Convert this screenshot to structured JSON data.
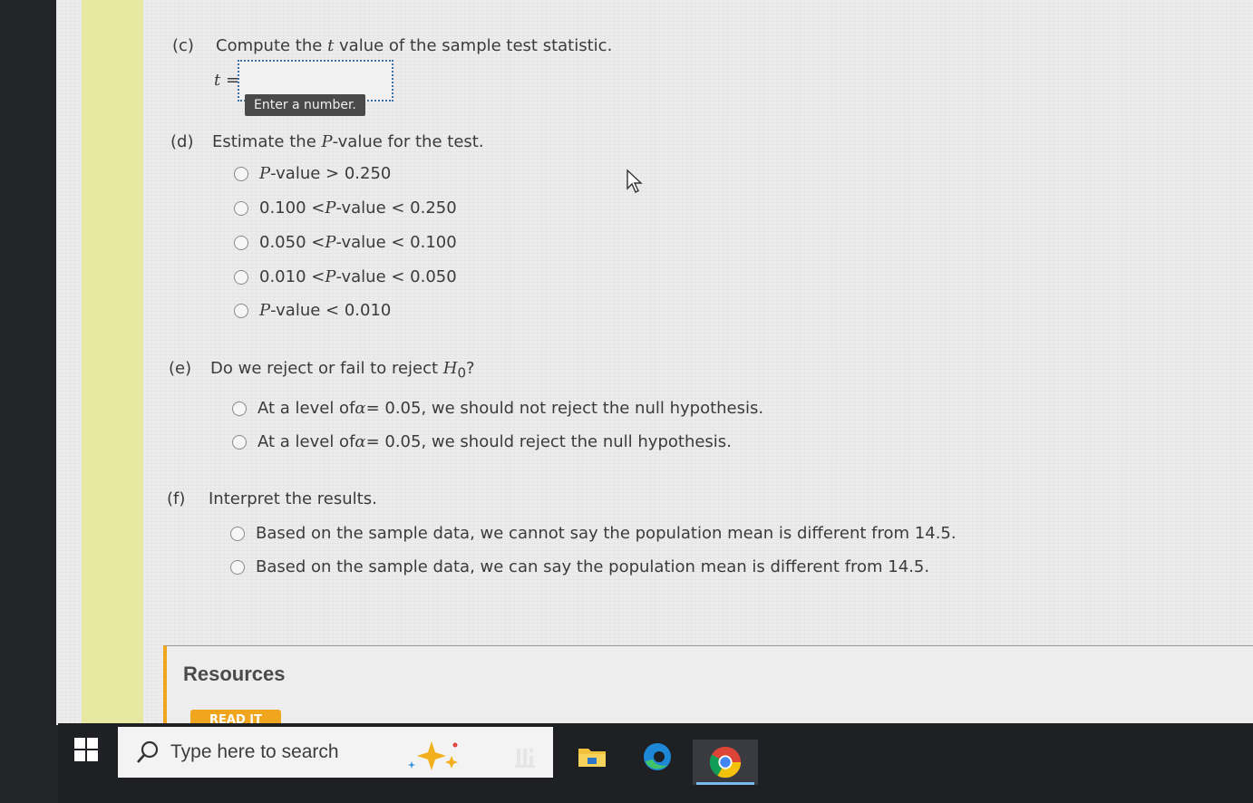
{
  "questions": {
    "c": {
      "label": "(c)",
      "text_pre": "Compute the ",
      "text_var": "t",
      "text_post": " value of the sample test statistic.",
      "input_var": "t",
      "input_eq": "=",
      "input_value": "",
      "tooltip": "Enter a number."
    },
    "d": {
      "label": "(d)",
      "text_pre": "Estimate the ",
      "text_var": "P",
      "text_post": "-value for the test.",
      "options": [
        {
          "pre": "",
          "var": "P",
          "post": "-value > 0.250"
        },
        {
          "pre": "0.100 < ",
          "var": "P",
          "post": "-value < 0.250"
        },
        {
          "pre": "0.050 < ",
          "var": "P",
          "post": "-value < 0.100"
        },
        {
          "pre": "0.010 < ",
          "var": "P",
          "post": "-value < 0.050"
        },
        {
          "pre": "",
          "var": "P",
          "post": "-value < 0.010"
        }
      ]
    },
    "e": {
      "label": "(e)",
      "text_pre": "Do we reject or fail to reject ",
      "text_var": "H",
      "text_sub": "0",
      "text_post": "?",
      "options": [
        {
          "pre": "At a level of ",
          "var": "α",
          "post": " = 0.05, we should not reject the null hypothesis."
        },
        {
          "pre": "At a level of ",
          "var": "α",
          "post": " = 0.05, we should reject the null hypothesis."
        }
      ]
    },
    "f": {
      "label": "(f)",
      "text": "Interpret the results.",
      "options": [
        {
          "text": "Based on the sample data, we cannot say the population mean is different from 14.5."
        },
        {
          "text": "Based on the sample data, we can say the population mean is different from 14.5."
        }
      ]
    }
  },
  "resources": {
    "title": "Resources",
    "button_label": "READ IT"
  },
  "taskbar": {
    "search_placeholder": "Type here to search",
    "icons": [
      "windows-start-icon",
      "search-icon",
      "task-view-icon",
      "file-explorer-icon",
      "edge-icon",
      "chrome-icon"
    ]
  },
  "colors": {
    "accent": "#f0a51e",
    "side_band": "#e7e8a2",
    "input_border": "#3a6ea5"
  }
}
